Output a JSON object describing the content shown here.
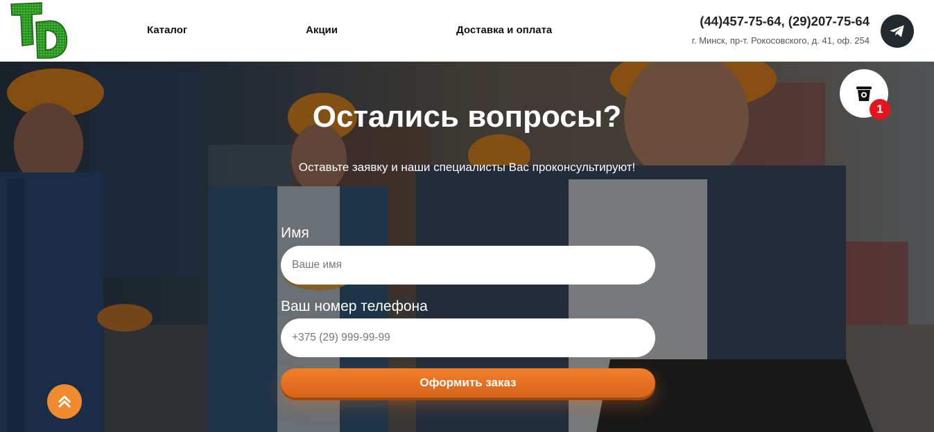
{
  "header": {
    "logo_text": "TD",
    "nav": {
      "catalog": "Каталог",
      "promo": "Акции",
      "delivery": "Доставка и оплата"
    },
    "phones": "(44)457-75-64, (29)207-75-64",
    "address": "г. Минск, пр-т. Рокосовского, д. 41, оф. 254",
    "telegram_icon": "telegram-icon"
  },
  "hero": {
    "title": "Остались вопросы?",
    "subtitle": "Оставьте заявку и наши специалисты Вас проконсультируют!",
    "form": {
      "name_label": "Имя",
      "name_placeholder": "Ваше имя",
      "phone_label": "Ваш номер телефона",
      "phone_placeholder": "+375 (29) 999-99-99",
      "submit_label": "Оформить заказ"
    }
  },
  "cart": {
    "icon": "bucket-icon",
    "count": "1"
  },
  "scroll_top": {
    "icon": "double-chevron-up-icon"
  },
  "colors": {
    "accent": "#e8741e",
    "badge": "#e8141c",
    "logo_green": "#2e9e2a",
    "telegram_bg": "#24292f"
  }
}
